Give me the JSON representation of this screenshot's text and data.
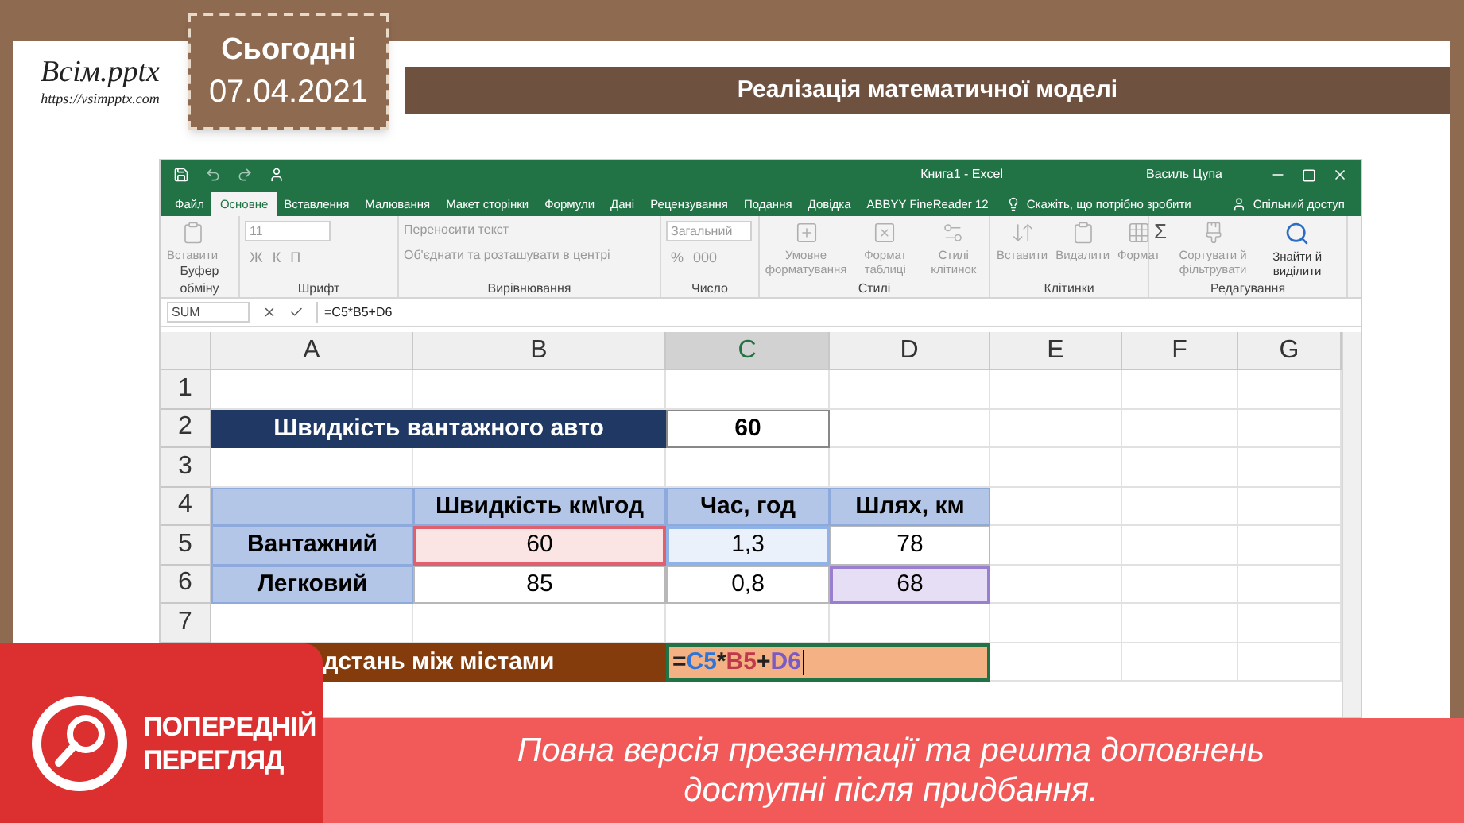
{
  "slide": {
    "logo": {
      "name": "Всім.pptx",
      "url": "https://vsimpptx.com"
    },
    "date_badge": {
      "label": "Сьогодні",
      "date": "07.04.2021"
    },
    "title": "Реалізація математичної моделі"
  },
  "excel": {
    "window_title": "Книга1 - Excel",
    "user": "Василь Цупа",
    "tabs": [
      {
        "label": "Файл",
        "selected": false
      },
      {
        "label": "Основне",
        "selected": true
      },
      {
        "label": "Вставлення",
        "selected": false
      },
      {
        "label": "Малювання",
        "selected": false
      },
      {
        "label": "Макет сторінки",
        "selected": false
      },
      {
        "label": "Формули",
        "selected": false
      },
      {
        "label": "Дані",
        "selected": false
      },
      {
        "label": "Рецензування",
        "selected": false
      },
      {
        "label": "Подання",
        "selected": false
      },
      {
        "label": "Довідка",
        "selected": false
      },
      {
        "label": "ABBYY FineReader 12",
        "selected": false
      }
    ],
    "tell_me": "Скажіть, що потрібно зробити",
    "share": "Спільний доступ",
    "ribbon_groups": [
      {
        "label": "Буфер обміну",
        "items": [
          {
            "kind": "large",
            "label": "Вставити"
          }
        ]
      },
      {
        "label": "Шрифт",
        "items": [
          {
            "kind": "field",
            "label": "11"
          },
          {
            "kind": "glyph",
            "label": "Ж"
          },
          {
            "kind": "glyph",
            "label": "К"
          },
          {
            "kind": "glyph",
            "label": "П"
          }
        ]
      },
      {
        "label": "Вирівнювання",
        "items": [
          {
            "kind": "wide",
            "label": "Переносити текст"
          },
          {
            "kind": "wide",
            "label": "Об'єднати та розташувати в центрі"
          }
        ]
      },
      {
        "label": "Число",
        "items": [
          {
            "kind": "field",
            "label": "Загальний"
          },
          {
            "kind": "glyph",
            "label": "%"
          },
          {
            "kind": "glyph",
            "label": "000"
          }
        ]
      },
      {
        "label": "Стилі",
        "items": [
          {
            "kind": "large",
            "label": "Умовне форматування"
          },
          {
            "kind": "large",
            "label": "Формат таблиці"
          },
          {
            "kind": "large",
            "label": "Стилі клітинок"
          }
        ]
      },
      {
        "label": "Клітинки",
        "items": [
          {
            "kind": "large",
            "label": "Вставити"
          },
          {
            "kind": "large",
            "label": "Видалити"
          },
          {
            "kind": "large",
            "label": "Формат"
          }
        ]
      },
      {
        "label": "Редагування",
        "items": [
          {
            "kind": "sum",
            "label": "Σ"
          },
          {
            "kind": "large",
            "label": "Сортувати й фільтрувати"
          },
          {
            "kind": "find",
            "label": "Знайти й виділити"
          }
        ]
      }
    ],
    "name_box": "SUM",
    "formula": "=C5*B5+D6",
    "columns": [
      {
        "label": "A",
        "selected": false
      },
      {
        "label": "B",
        "selected": false
      },
      {
        "label": "C",
        "selected": true
      },
      {
        "label": "D",
        "selected": false
      },
      {
        "label": "E",
        "selected": false
      },
      {
        "label": "F",
        "selected": false
      },
      {
        "label": "G",
        "selected": false
      }
    ],
    "rows": [
      {
        "number": "1",
        "selected": false,
        "cells": []
      },
      {
        "number": "2",
        "selected": false,
        "cells": [
          {
            "kind": "title",
            "text": "Швидкість вантажного авто"
          },
          {
            "kind": "value",
            "text": "60"
          }
        ]
      },
      {
        "number": "3",
        "selected": false,
        "cells": []
      },
      {
        "number": "4",
        "selected": false,
        "cells": [
          {
            "kind": "header"
          },
          {
            "kind": "header",
            "text": "Швидкість км\\год"
          },
          {
            "kind": "header",
            "text": "Час, год"
          },
          {
            "kind": "header",
            "text": "Шлях, км"
          }
        ]
      },
      {
        "number": "5",
        "selected": false,
        "cells": [
          {
            "kind": "label",
            "text": "Вантажний"
          },
          {
            "kind": "ref_red",
            "text": "60"
          },
          {
            "kind": "ref_blue",
            "text": "1,3"
          },
          {
            "kind": "plain",
            "text": "78"
          }
        ]
      },
      {
        "number": "6",
        "selected": false,
        "cells": [
          {
            "kind": "label",
            "text": "Легковий"
          },
          {
            "kind": "plain",
            "text": "85"
          },
          {
            "kind": "plain",
            "text": "0,8"
          },
          {
            "kind": "ref_purple",
            "text": "68"
          }
        ]
      },
      {
        "number": "7",
        "selected": false,
        "cells": []
      },
      {
        "cells": [
          {
            "kind": "result_label",
            "text": "дстань між містами"
          },
          {
            "kind": "formula",
            "parts": [
              {
                "text": "=",
                "color": "#222222"
              },
              {
                "text": "C5",
                "color": "#2e75d6"
              },
              {
                "text": "*",
                "color": "#222222"
              },
              {
                "text": "B5",
                "color": "#c0394b"
              },
              {
                "text": "+",
                "color": "#222222"
              },
              {
                "text": "D6",
                "color": "#7a5bc4"
              }
            ]
          }
        ]
      }
    ]
  },
  "banner": {
    "badge_lines": [
      "ПОПЕРЕДНІЙ",
      "ПЕРЕГЛЯД"
    ],
    "message_lines": [
      "Повна версія презентації та решта доповнень",
      "доступні після придбання."
    ]
  }
}
